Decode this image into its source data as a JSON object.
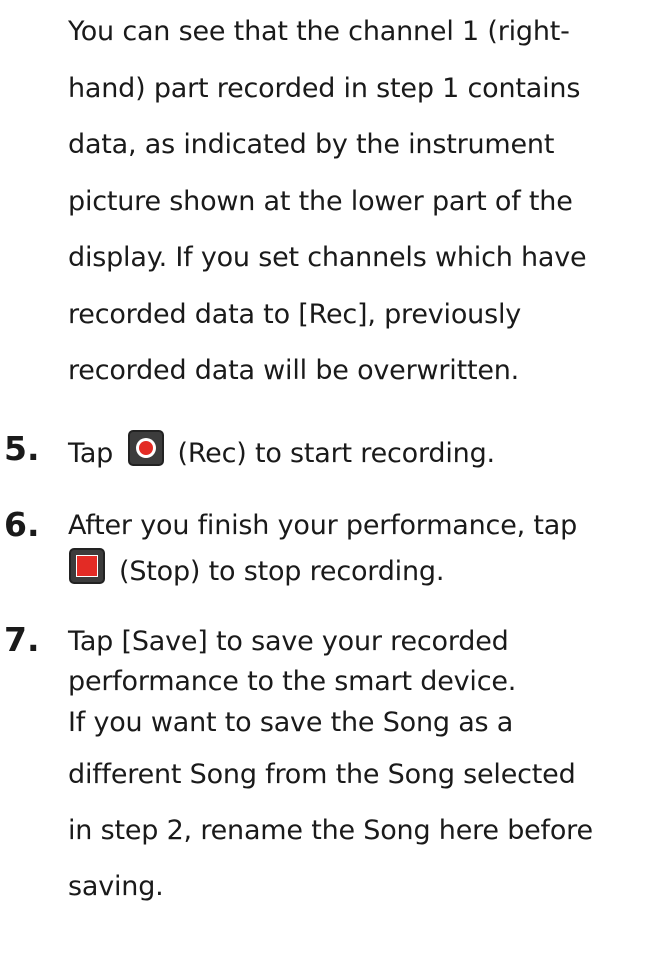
{
  "intro": {
    "lines": [
      "You can see that the channel 1 (right-",
      "hand) part recorded in step 1 contains",
      "data, as indicated by the instrument",
      "picture shown at the lower part of the",
      "display. If you set channels which have",
      "recorded data to [Rec], previously",
      "recorded data will be overwritten."
    ]
  },
  "steps": [
    {
      "number": "5.",
      "before_icon": "Tap",
      "icon": "rec-icon",
      "after_icon": "(Rec) to start recording."
    },
    {
      "number": "6.",
      "line1": "After you finish your performance, tap",
      "icon": "stop-icon",
      "after_icon": "(Stop) to stop recording."
    },
    {
      "number": "7.",
      "lines": [
        "Tap [Save] to save your recorded",
        "performance to the smart device.",
        "If you want to save the Song as a",
        "different Song from the Song selected",
        "in step 2, rename the Song here before",
        "saving."
      ]
    }
  ],
  "colors": {
    "text": "#1a1a1a",
    "icon_bg": "#3c3c3c",
    "icon_red": "#e32b25"
  }
}
